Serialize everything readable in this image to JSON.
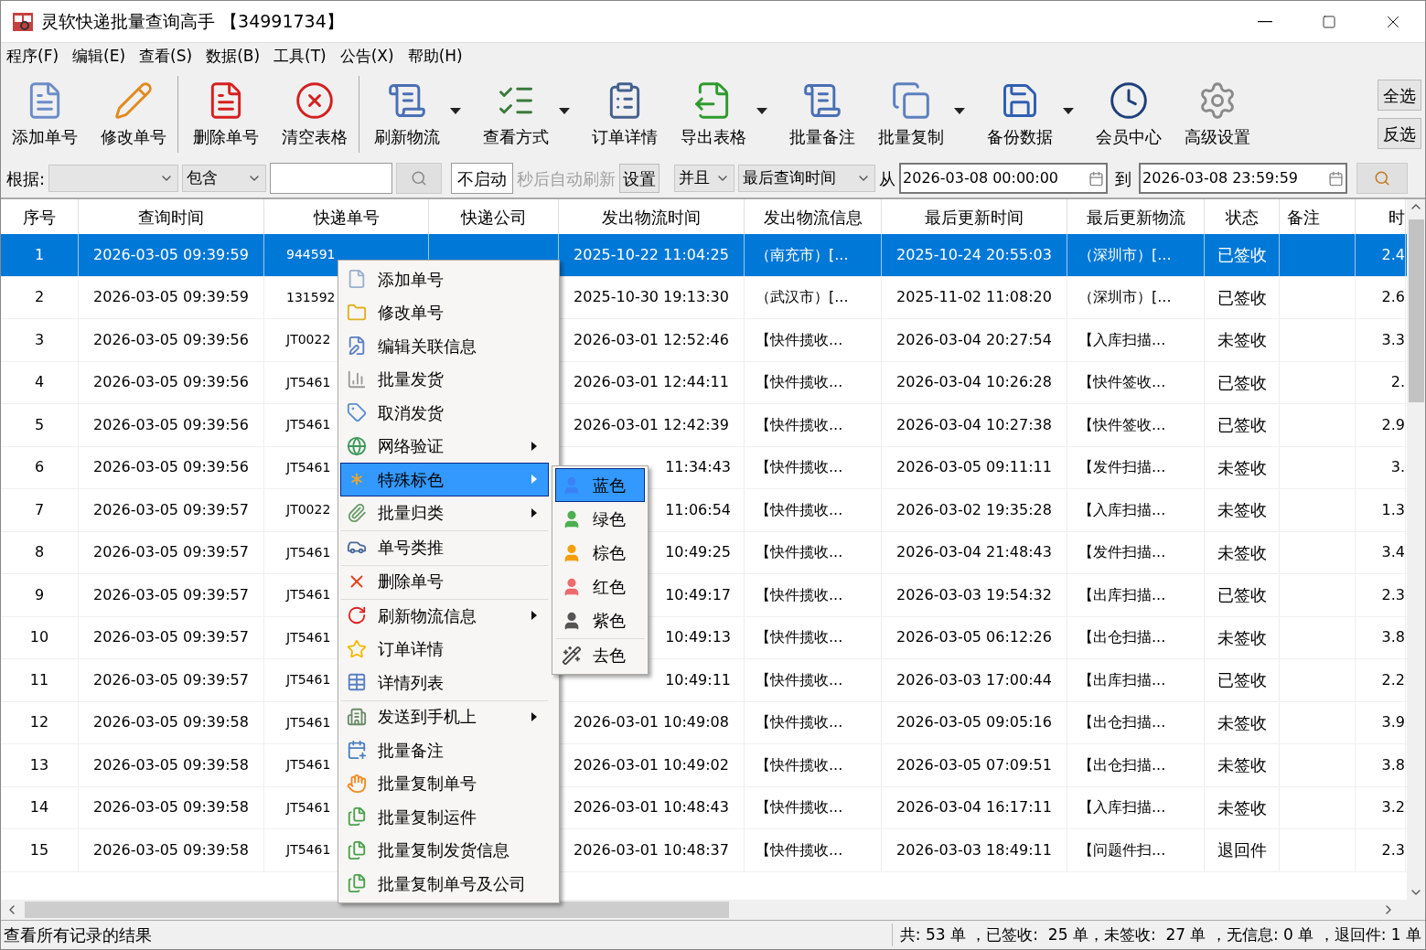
{
  "window": {
    "title": "灵软快递批量查询高手 【34991734】"
  },
  "menu_bar": [
    "程序(F)",
    "编辑(E)",
    "查看(S)",
    "数据(B)",
    "工具(T)",
    "公告(X)",
    "帮助(H)"
  ],
  "toolbar": {
    "buttons": [
      {
        "label": "添加单号",
        "dropdown": false,
        "separator_after": false
      },
      {
        "label": "修改单号",
        "dropdown": false,
        "separator_after": true
      },
      {
        "label": "删除单号",
        "dropdown": false,
        "separator_after": false
      },
      {
        "label": "清空表格",
        "dropdown": false,
        "separator_after": true
      },
      {
        "label": "刷新物流",
        "dropdown": true,
        "separator_after": false
      },
      {
        "label": "查看方式",
        "dropdown": true,
        "separator_after": false
      },
      {
        "label": "订单详情",
        "dropdown": false,
        "separator_after": false
      },
      {
        "label": "导出表格",
        "dropdown": true,
        "separator_after": false
      },
      {
        "label": "批量备注",
        "dropdown": false,
        "separator_after": false
      },
      {
        "label": "批量复制",
        "dropdown": true,
        "separator_after": false
      },
      {
        "label": "备份数据",
        "dropdown": true,
        "separator_after": false
      },
      {
        "label": "会员中心",
        "dropdown": false,
        "separator_after": false
      },
      {
        "label": "高级设置",
        "dropdown": false,
        "separator_after": false
      }
    ],
    "side_buttons": [
      "全选",
      "反选"
    ]
  },
  "filter": {
    "label": "根据:",
    "match": "包含",
    "auto_refresh": "不启动",
    "auto_refresh_hint": "秒后自动刷新",
    "settings": "设置",
    "logic": "并且",
    "time_field": "最后查询时间",
    "from_label": "从",
    "from": "2026-03-08 00:00:00",
    "to_label": "到",
    "to": "2026-03-08 23:59:59"
  },
  "table": {
    "columns": [
      "序号",
      "查询时间",
      "快递单号",
      "快递公司",
      "发出物流时间",
      "发出物流信息",
      "最后更新时间",
      "最后更新物流",
      "状态",
      "备注",
      "时"
    ],
    "rows": [
      {
        "selected": true,
        "cells": [
          "1",
          "2026-03-05 09:39:59",
          "944591",
          "",
          "2025-10-22 11:04:25",
          "（南充市）[...",
          "2025-10-24 20:55:03",
          "（深圳市）[...",
          "已签收",
          "",
          "2.4"
        ]
      },
      {
        "selected": false,
        "cells": [
          "2",
          "2026-03-05 09:39:59",
          "131592",
          "",
          "2025-10-30 19:13:30",
          "（武汉市）[...",
          "2025-11-02 11:08:20",
          "（深圳市）[...",
          "已签收",
          "",
          "2.6"
        ]
      },
      {
        "selected": false,
        "cells": [
          "3",
          "2026-03-05 09:39:56",
          "JT0022",
          "",
          "2026-03-01 12:52:46",
          "【快件揽收...",
          "2026-03-04 20:27:54",
          "【入库扫描...",
          "未签收",
          "",
          "3.3"
        ]
      },
      {
        "selected": false,
        "cells": [
          "4",
          "2026-03-05 09:39:56",
          "JT5461",
          "",
          "2026-03-01 12:44:11",
          "【快件揽收...",
          "2026-03-04 10:26:28",
          "【快件签收...",
          "已签收",
          "",
          "2."
        ]
      },
      {
        "selected": false,
        "cells": [
          "5",
          "2026-03-05 09:39:56",
          "JT5461",
          "",
          "2026-03-01 12:42:39",
          "【快件揽收...",
          "2026-03-04 10:27:38",
          "【快件签收...",
          "已签收",
          "",
          "2.9"
        ]
      },
      {
        "selected": false,
        "cells": [
          "6",
          "2026-03-05 09:39:56",
          "JT5461",
          "",
          "11:34:43",
          "【快件揽收...",
          "2026-03-05 09:11:11",
          "【发件扫描...",
          "未签收",
          "",
          "3."
        ]
      },
      {
        "selected": false,
        "cells": [
          "7",
          "2026-03-05 09:39:57",
          "JT0022",
          "",
          "11:06:54",
          "【快件揽收...",
          "2026-03-02 19:35:28",
          "【入库扫描...",
          "未签收",
          "",
          "1.3"
        ]
      },
      {
        "selected": false,
        "cells": [
          "8",
          "2026-03-05 09:39:57",
          "JT5461",
          "",
          "10:49:25",
          "【快件揽收...",
          "2026-03-04 21:48:43",
          "【发件扫描...",
          "未签收",
          "",
          "3.4"
        ]
      },
      {
        "selected": false,
        "cells": [
          "9",
          "2026-03-05 09:39:57",
          "JT5461",
          "",
          "10:49:17",
          "【快件揽收...",
          "2026-03-03 19:54:32",
          "【出库扫描...",
          "已签收",
          "",
          "2.3"
        ]
      },
      {
        "selected": false,
        "cells": [
          "10",
          "2026-03-05 09:39:57",
          "JT5461",
          "",
          "10:49:13",
          "【快件揽收...",
          "2026-03-05 06:12:26",
          "【出仓扫描...",
          "未签收",
          "",
          "3.8"
        ]
      },
      {
        "selected": false,
        "cells": [
          "11",
          "2026-03-05 09:39:57",
          "JT5461",
          "",
          "10:49:11",
          "【快件揽收...",
          "2026-03-03 17:00:44",
          "【出库扫描...",
          "已签收",
          "",
          "2.2"
        ]
      },
      {
        "selected": false,
        "cells": [
          "12",
          "2026-03-05 09:39:58",
          "JT5461",
          "",
          "2026-03-01 10:49:08",
          "【快件揽收...",
          "2026-03-05 09:05:16",
          "【出仓扫描...",
          "未签收",
          "",
          "3.9"
        ]
      },
      {
        "selected": false,
        "cells": [
          "13",
          "2026-03-05 09:39:58",
          "JT5461",
          "",
          "2026-03-01 10:49:02",
          "【快件揽收...",
          "2026-03-05 07:09:51",
          "【出仓扫描...",
          "未签收",
          "",
          "3.8"
        ]
      },
      {
        "selected": false,
        "cells": [
          "14",
          "2026-03-05 09:39:58",
          "JT5461",
          "",
          "2026-03-01 10:48:43",
          "【快件揽收...",
          "2026-03-04 16:17:11",
          "【入库扫描...",
          "未签收",
          "",
          "3.2"
        ]
      },
      {
        "selected": false,
        "cells": [
          "15",
          "2026-03-05 09:39:58",
          "JT5461",
          "",
          "2026-03-01 10:48:37",
          "【快件揽收...",
          "2026-03-03 18:49:11",
          "【问题件扫...",
          "退回件",
          "",
          "2.3"
        ]
      }
    ]
  },
  "context_menu": {
    "items": [
      {
        "label": "添加单号",
        "submenu": false,
        "selected": false,
        "separator_before": false
      },
      {
        "label": "修改单号",
        "submenu": false,
        "selected": false,
        "separator_before": false
      },
      {
        "label": "编辑关联信息",
        "submenu": false,
        "selected": false,
        "separator_before": false
      },
      {
        "label": "批量发货",
        "submenu": false,
        "selected": false,
        "separator_before": false
      },
      {
        "label": "取消发货",
        "submenu": false,
        "selected": false,
        "separator_before": false
      },
      {
        "label": "网络验证",
        "submenu": true,
        "selected": false,
        "separator_before": false
      },
      {
        "label": "特殊标色",
        "submenu": true,
        "selected": true,
        "separator_before": false
      },
      {
        "label": "批量归类",
        "submenu": true,
        "selected": false,
        "separator_before": false
      },
      {
        "label": "单号类推",
        "submenu": false,
        "selected": false,
        "separator_before": true
      },
      {
        "label": "删除单号",
        "submenu": false,
        "selected": false,
        "separator_before": true
      },
      {
        "label": "刷新物流信息",
        "submenu": true,
        "selected": false,
        "separator_before": true
      },
      {
        "label": "订单详情",
        "submenu": false,
        "selected": false,
        "separator_before": false
      },
      {
        "label": "详情列表",
        "submenu": false,
        "selected": false,
        "separator_before": false
      },
      {
        "label": "发送到手机上",
        "submenu": true,
        "selected": false,
        "separator_before": true
      },
      {
        "label": "批量备注",
        "submenu": false,
        "selected": false,
        "separator_before": false
      },
      {
        "label": "批量复制单号",
        "submenu": false,
        "selected": false,
        "separator_before": false
      },
      {
        "label": "批量复制运件",
        "submenu": false,
        "selected": false,
        "separator_before": false
      },
      {
        "label": "批量复制发货信息",
        "submenu": false,
        "selected": false,
        "separator_before": false
      },
      {
        "label": "批量复制单号及公司",
        "submenu": false,
        "selected": false,
        "separator_before": false
      }
    ]
  },
  "color_submenu": {
    "items": [
      {
        "label": "蓝色",
        "selected": true,
        "color": "#3b82f6",
        "separator_before": false
      },
      {
        "label": "绿色",
        "selected": false,
        "color": "#4caf50",
        "separator_before": false
      },
      {
        "label": "棕色",
        "selected": false,
        "color": "#f59e0b",
        "separator_before": false
      },
      {
        "label": "红色",
        "selected": false,
        "color": "#ef6b6b",
        "separator_before": false
      },
      {
        "label": "紫色",
        "selected": false,
        "color": "#555555",
        "separator_before": false
      },
      {
        "label": "去色",
        "selected": false,
        "separator_before": true
      }
    ]
  },
  "status_bar": {
    "left": "查看所有记录的结果",
    "right": "共: 53 单 ，已签收:  25 单，未签收:  27 单 ，无信息: 0 单 ，退回件: 1 单"
  }
}
